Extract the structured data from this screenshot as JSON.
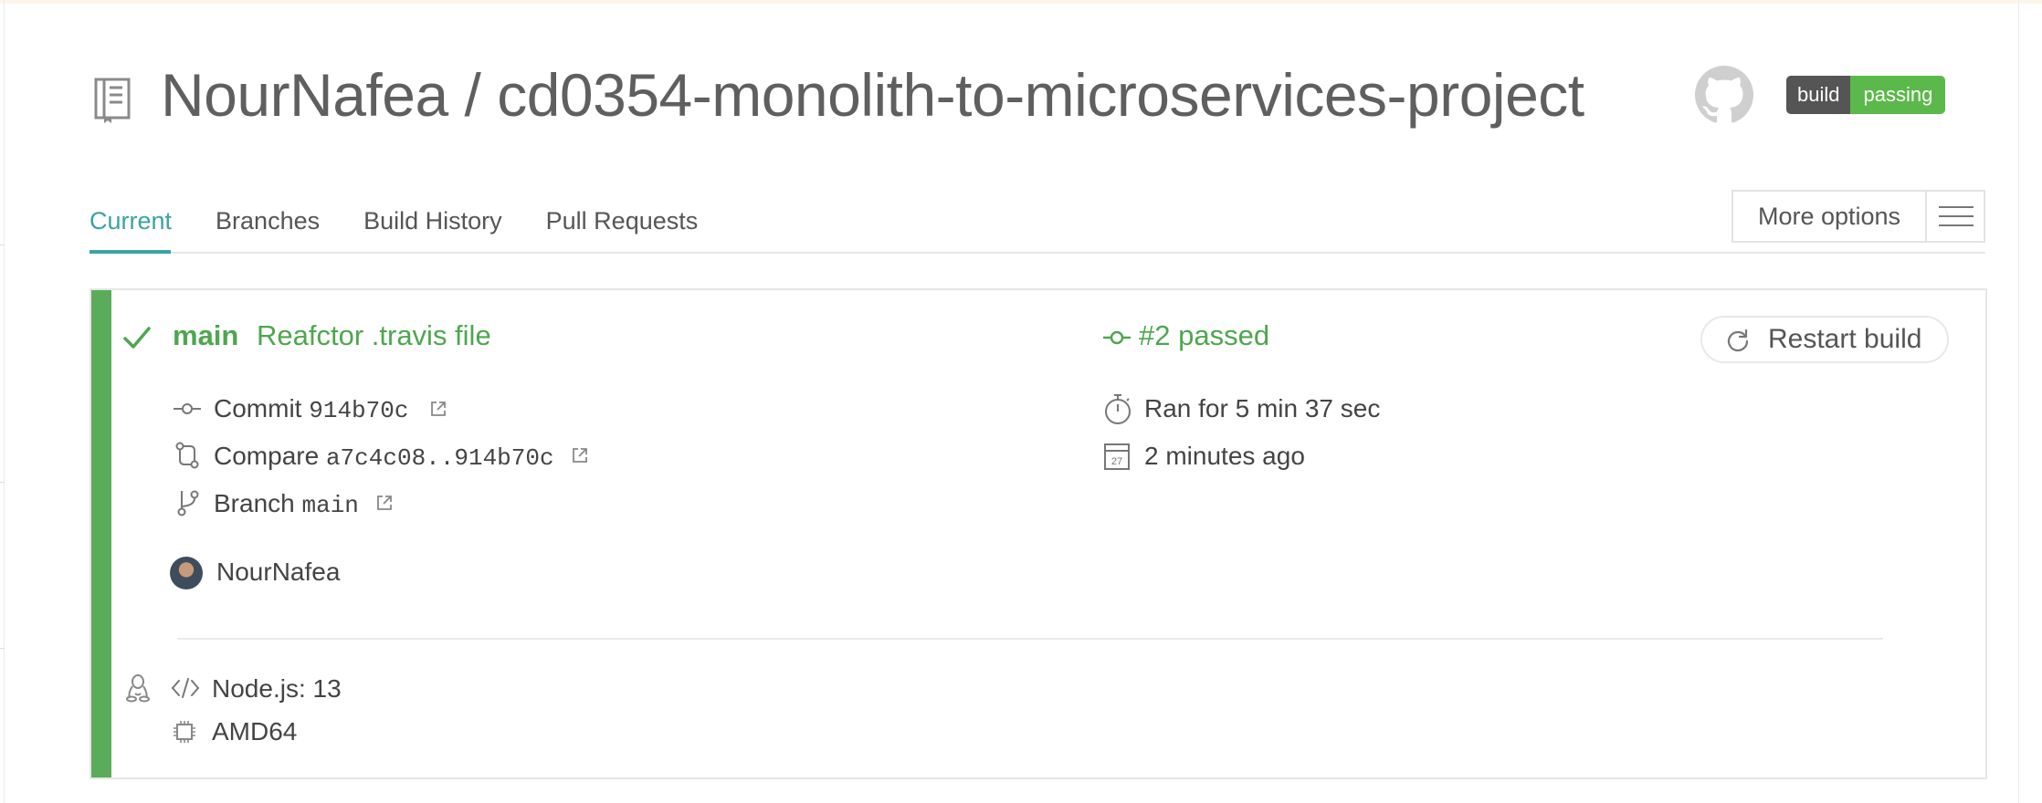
{
  "repo": {
    "owner": "NourNafea",
    "separator": "/",
    "name": "cd0354-monolith-to-microservices-project",
    "icon": "repo-icon",
    "github_icon": "github-icon"
  },
  "badge": {
    "label": "build",
    "status": "passing",
    "label_color": "#555555",
    "status_color": "#5bb84a"
  },
  "tabs": [
    {
      "label": "Current",
      "active": true
    },
    {
      "label": "Branches"
    },
    {
      "label": "Build History"
    },
    {
      "label": "Pull Requests"
    }
  ],
  "more_options": {
    "label": "More options",
    "icon": "hamburger-menu-icon"
  },
  "build": {
    "state_icon": "checkmark-icon",
    "branch": "main",
    "message": "Reafctor .travis file",
    "status_icon": "commit-icon",
    "status": "#2 passed",
    "restart_label": "Restart build",
    "restart_icon": "restart-icon",
    "accent_color": "#5aac5a",
    "commit": {
      "label": "Commit",
      "hash": "914b70c"
    },
    "compare": {
      "label": "Compare",
      "range": "a7c4c08..914b70c"
    },
    "branch_row": {
      "label": "Branch",
      "name": "main"
    },
    "author": "NourNafea",
    "duration": "Ran for 5 min 37 sec",
    "finished": "2 minutes ago",
    "calendar_day": "27",
    "language": "Node.js: 13",
    "arch": "AMD64"
  }
}
